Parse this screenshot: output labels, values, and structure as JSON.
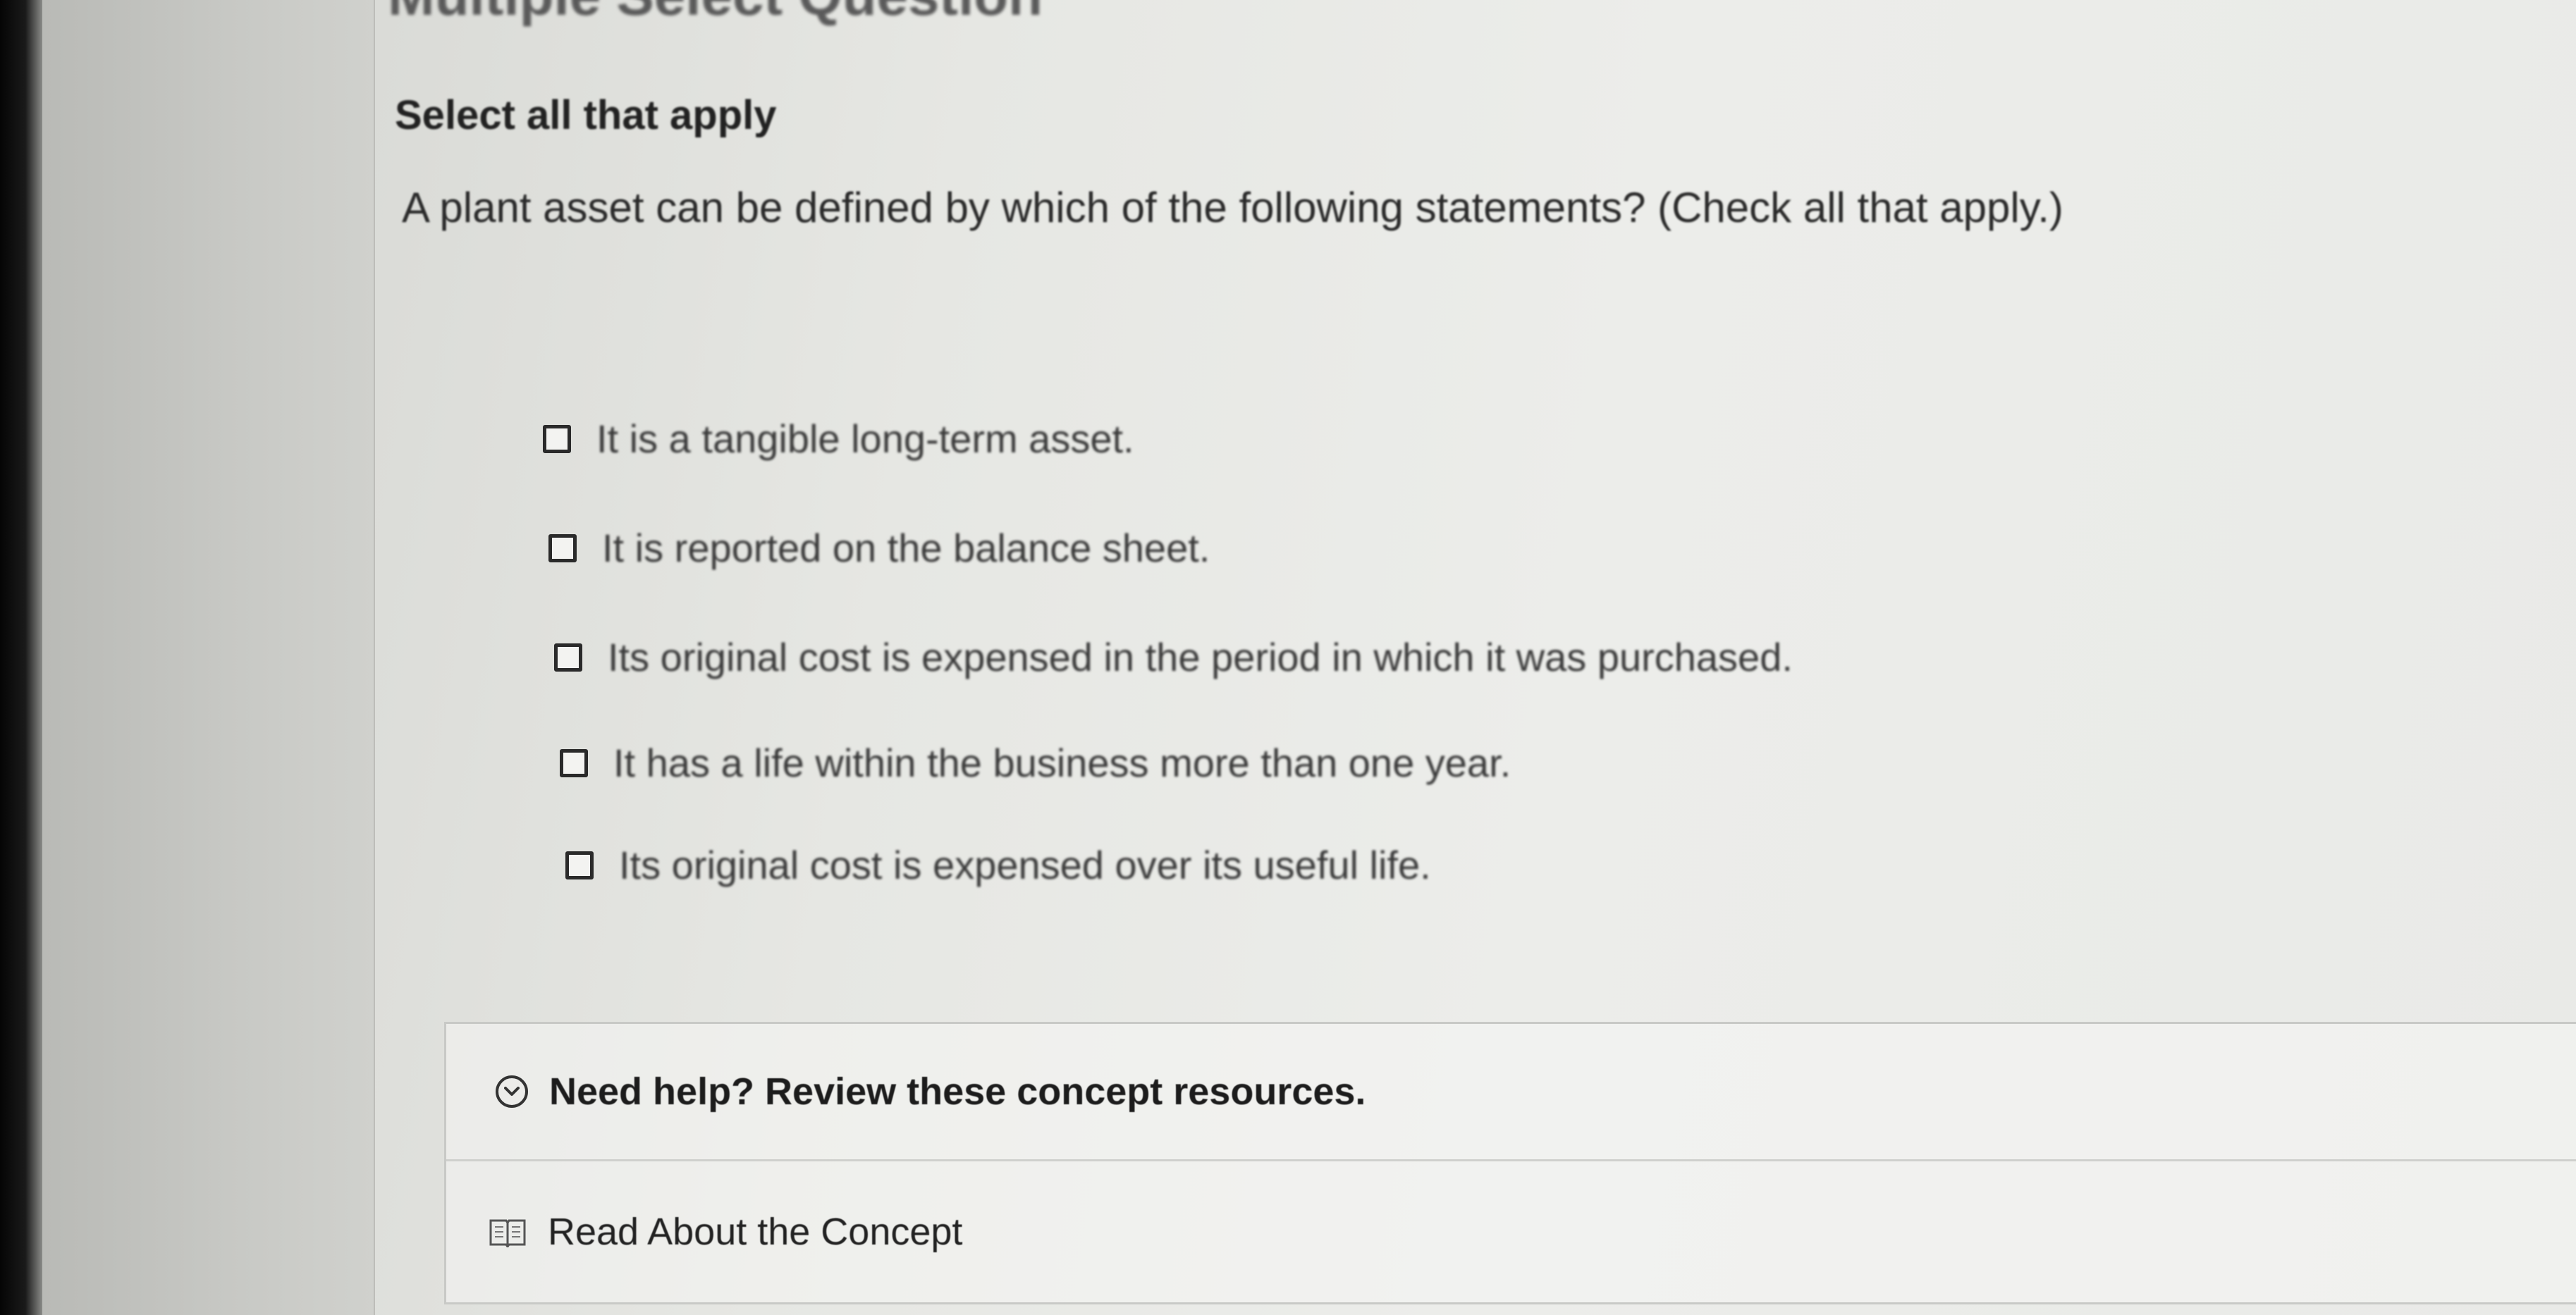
{
  "page": {
    "title_partial": "Multiple Select Question",
    "instruction": "Select all that apply",
    "question": "A plant asset can be defined by which of the following statements? (Check all that apply.)"
  },
  "options": [
    {
      "label": "It is a tangible long-term asset.",
      "checked": false
    },
    {
      "label": "It is reported on the balance sheet.",
      "checked": false
    },
    {
      "label": "Its original cost is expensed in the period in which it was purchased.",
      "checked": false
    },
    {
      "label": "It has a life within the business more than one year.",
      "checked": false
    },
    {
      "label": "Its original cost is expensed over its useful life.",
      "checked": false
    }
  ],
  "help": {
    "header_label": "Need help? Review these concept resources.",
    "header_icon": "chevron-down-circle-icon",
    "resources": [
      {
        "label": "Read About the Concept",
        "icon": "book-icon"
      }
    ]
  }
}
